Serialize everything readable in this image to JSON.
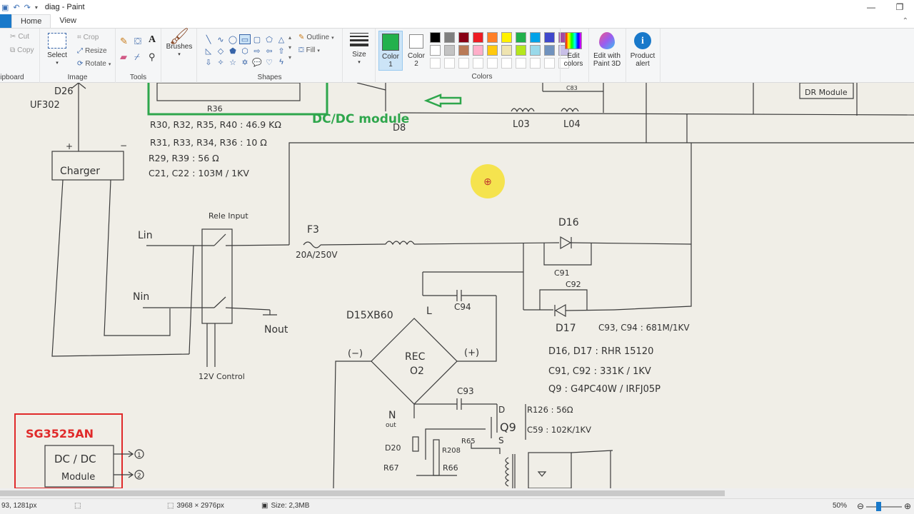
{
  "window": {
    "title": "diag - Paint",
    "minimize": "—",
    "restore": "❐"
  },
  "tabs": {
    "home": "Home",
    "view": "View"
  },
  "ribbon": {
    "clipboard": {
      "cut": "Cut",
      "copy": "Copy",
      "label": "lipboard"
    },
    "image": {
      "select": "Select",
      "crop": "Crop",
      "resize": "Resize",
      "rotate": "Rotate",
      "label": "Image"
    },
    "tools": {
      "label": "Tools"
    },
    "brushes": {
      "label": "Brushes"
    },
    "shapes": {
      "outline": "Outline",
      "fill": "Fill",
      "label": "Shapes"
    },
    "size": {
      "label": "Size"
    },
    "color1": {
      "label": "Color",
      "num": "1",
      "value": "#22b14c"
    },
    "color2": {
      "label": "Color",
      "num": "2",
      "value": "#ffffff"
    },
    "colors": {
      "label": "Colors",
      "row1": [
        "#000000",
        "#7f7f7f",
        "#880015",
        "#ed1c24",
        "#ff7f27",
        "#fff200",
        "#22b14c",
        "#00a2e8",
        "#3f48cc",
        "#a349a4"
      ],
      "row2": [
        "#ffffff",
        "#c3c3c3",
        "#b97a57",
        "#ffaec9",
        "#ffc90e",
        "#efe4b0",
        "#b5e61d",
        "#99d9ea",
        "#7092be",
        "#c8bfe7"
      ]
    },
    "edit_colors": {
      "line1": "Edit",
      "line2": "colors"
    },
    "paint3d": {
      "line1": "Edit with",
      "line2": "Paint 3D"
    },
    "product_alert": {
      "line1": "Product",
      "line2": "alert"
    }
  },
  "canvas": {
    "annotations": {
      "dcdc_label": "DC/DC module",
      "sg_label": "SG3525AN"
    },
    "handwriting": {
      "d26": "D26",
      "uf302": "UF302",
      "r36": "R36",
      "d8": "D8",
      "l03": "L03",
      "l04": "L04",
      "c83": "C83",
      "dr_module": "DR Module",
      "r_line1": "R30, R32, R35, R40 : 46.9 KΩ",
      "r_line2": "R31, R33, R34, R36 : 10 Ω",
      "r_line3": "R29, R39 : 56 Ω",
      "c_line": "C21, C22 : 103M / 1KV",
      "charger": "Charger",
      "plus": "+",
      "minus": "−",
      "rele": "Rele Input",
      "lin": "Lin",
      "nin": "Nin",
      "nout": "Nout",
      "ctrl": "12V Control",
      "f3": "F3",
      "fuse": "20A/250V",
      "d16": "D16",
      "c91": "C91",
      "c92": "C92",
      "d17": "D17",
      "c94": "C94",
      "bridge": "D15XB60",
      "l_pin": "L",
      "rec": "REC",
      "o2": "O2",
      "neg": "(−)",
      "pos": "(+)",
      "c93": "C93",
      "nout2": "N",
      "out": "out",
      "d_pin": "D",
      "s_pin": "S",
      "q9": "Q9",
      "r126": "R126 : 56Ω",
      "c59": "C59 : 102K/1KV",
      "r65": "R65",
      "d20": "D20",
      "r208": "R208",
      "r67": "R67",
      "r66": "R66",
      "spec1": "C93, C94 : 681M/1KV",
      "spec2": "D16, D17 : RHR 15120",
      "spec3": "C91, C92 : 331K / 1KV",
      "spec4": "Q9 : G4PC40W / IRFJ05P",
      "dcdc_box_l1": "DC / DC",
      "dcdc_box_l2": "Module",
      "out1": "1",
      "out2": "2"
    }
  },
  "status": {
    "position": "93, 1281px",
    "dimensions": "3968 × 2976px",
    "size": "Size: 2,3MB",
    "zoom": "50%"
  }
}
